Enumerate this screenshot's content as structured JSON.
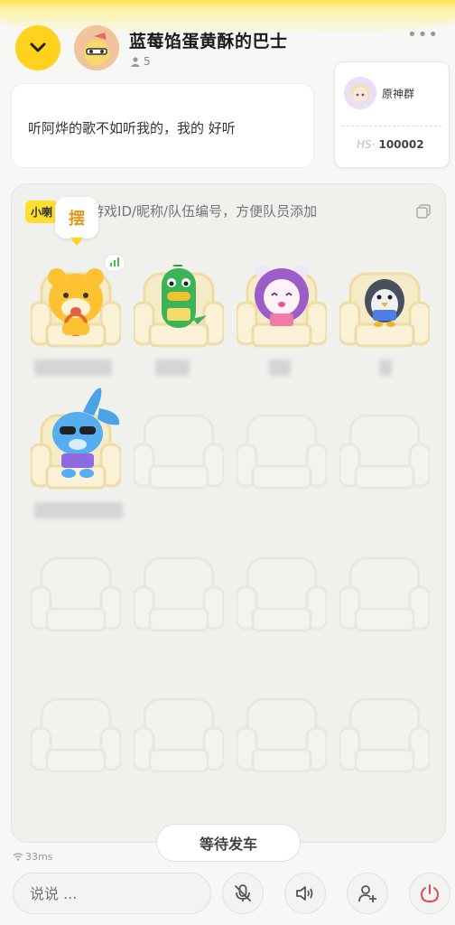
{
  "header": {
    "title": "蓝莓馅蛋黄酥的巴士",
    "member_count": "5",
    "icons": {
      "back": "chevron-down-icon",
      "more": "more-dots-icon",
      "members": "person-icon"
    }
  },
  "notice": {
    "text": "听阿烨的歌不如听我的，我的 好听"
  },
  "group_card": {
    "name": "原神群",
    "id_prefix": "HS·",
    "id": "100002"
  },
  "team": {
    "tag": "小喇",
    "placeholder": "输入游戏ID/昵称/队伍编号，方便队员添加",
    "copy_icon": "copy-icon"
  },
  "speech_bubble": "摆",
  "wait_button": "等待发车",
  "ping": "33ms",
  "chat": {
    "placeholder": "说说 ..."
  },
  "toolbar": {
    "icons": [
      "mic-off-icon",
      "speaker-icon",
      "add-user-icon",
      "power-icon"
    ]
  },
  "colors": {
    "accent": "#ffd21f",
    "signal": "#3bc35a",
    "power": "#e5484d"
  }
}
